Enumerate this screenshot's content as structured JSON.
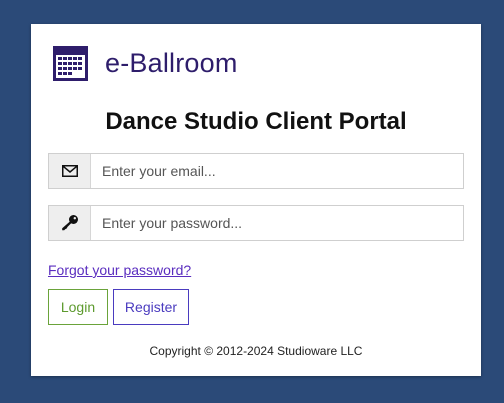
{
  "brand": {
    "name": "e-Ballroom",
    "icon": "calendar-grid-icon",
    "color": "#2e1d6b"
  },
  "portal_title": "Dance Studio Client Portal",
  "email": {
    "icon": "envelope-icon",
    "placeholder": "Enter your email...",
    "value": ""
  },
  "password": {
    "icon": "key-icon",
    "placeholder": "Enter your password...",
    "value": ""
  },
  "forgot_password_label": "Forgot your password?",
  "buttons": {
    "login_label": "Login",
    "register_label": "Register"
  },
  "copyright": "Copyright © 2012-2024 Studioware LLC",
  "colors": {
    "background": "#2b4a78",
    "login": "#5d9a2e",
    "register": "#4a3bbf",
    "link": "#5a2dbf"
  }
}
